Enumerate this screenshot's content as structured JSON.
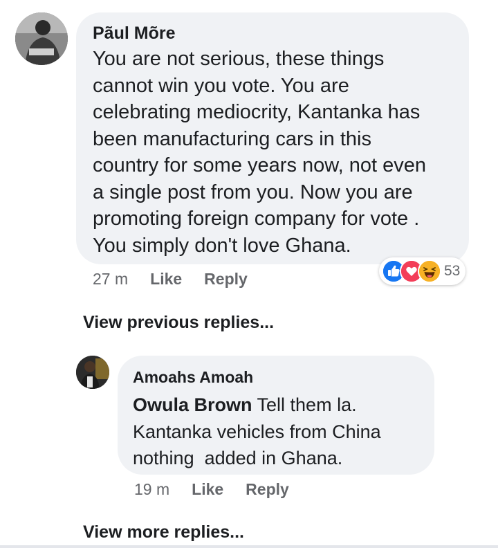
{
  "comment": {
    "author": "Pãul Mõre",
    "text_lines": [
      "You are not serious, these things",
      "cannot win you vote. You are",
      "celebrating mediocrity, Kantanka has",
      "been manufacturing cars in this",
      "country for some years now, not even",
      "a single post from you. Now you are",
      "promoting foreign company for vote .",
      "You simply don't love Ghana."
    ],
    "time": "27 m",
    "like_label": "Like",
    "reply_label": "Reply",
    "reactions": {
      "icons": [
        "like-icon",
        "love-icon",
        "haha-icon"
      ],
      "count": "53"
    }
  },
  "view_previous_label": "View previous replies...",
  "reply": {
    "author": "Amoahs Amoah",
    "mention": "Owula Brown",
    "first_line_rest": " Tell them la.",
    "text_lines": [
      "Kantanka vehicles from China",
      "nothing  added in Ghana."
    ],
    "time": "19 m",
    "like_label": "Like",
    "reply_label": "Reply"
  },
  "view_more_label": "View more replies...",
  "colors": {
    "bubble": "#f0f2f5",
    "meta": "#65676b",
    "like_blue": "#1877f2",
    "love_red": "#f33e58",
    "haha_yellow": "#f7b125"
  }
}
